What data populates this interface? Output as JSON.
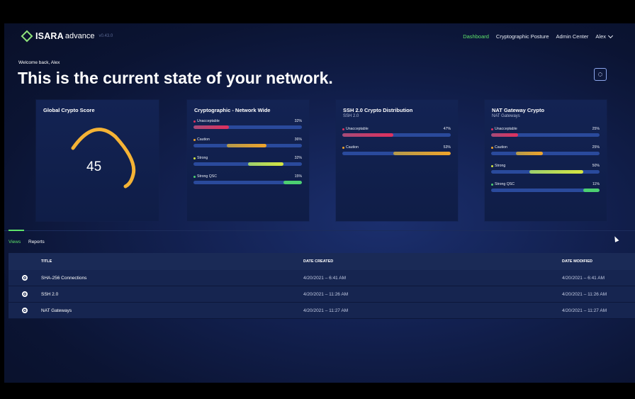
{
  "app": {
    "brand": "ISARA",
    "product": "advance",
    "version": "v0.43.0"
  },
  "nav": {
    "links": [
      "Dashboard",
      "Cryptographic Posture",
      "Admin Center"
    ],
    "active": "Dashboard",
    "user": "Alex"
  },
  "hero": {
    "welcome": "Welcome back, Alex",
    "headline": "This is the current state of your network."
  },
  "cards": {
    "global": {
      "title": "Global Crypto Score",
      "score": "45",
      "gauge_color": "#f5b335"
    },
    "network": {
      "title": "Cryptographic - Network Wide",
      "metrics": [
        {
          "label": "Unacceptable",
          "value": "32%",
          "color": "#e0305e"
        },
        {
          "label": "Caution",
          "value": "36%",
          "color": "#f0a42a"
        },
        {
          "label": "Strong",
          "value": "32%",
          "color": "#d6e640"
        },
        {
          "label": "Strong QSC",
          "value": "15%",
          "color": "#4cd071"
        }
      ]
    },
    "ssh": {
      "title": "SSH 2.0 Crypto Distribution",
      "subtitle": "SSH 2.0",
      "metrics": [
        {
          "label": "Unacceptable",
          "value": "47%",
          "color": "#e0305e"
        },
        {
          "label": "Caution",
          "value": "53%",
          "color": "#f0a42a"
        }
      ]
    },
    "nat": {
      "title": "NAT Gateway Crypto",
      "subtitle": "NAT Gateways",
      "metrics": [
        {
          "label": "Unacceptable",
          "value": "25%",
          "color": "#e0305e"
        },
        {
          "label": "Caution",
          "value": "25%",
          "color": "#f0a42a"
        },
        {
          "label": "Strong",
          "value": "50%",
          "color": "#d6e640"
        },
        {
          "label": "Strong QSC",
          "value": "11%",
          "color": "#4cd071"
        }
      ]
    }
  },
  "tabs": {
    "views": "Views",
    "reports": "Reports"
  },
  "table": {
    "headers": {
      "title": "TITLE",
      "created": "DATE CREATED",
      "modified": "DATE MODIFIED"
    },
    "rows": [
      {
        "title": "SHA-256 Connections",
        "created": "4/20/2021 – 6:41 AM",
        "modified": "4/20/2021 – 6:41 AM"
      },
      {
        "title": "SSH 2.0",
        "created": "4/20/2021 – 11:26 AM",
        "modified": "4/20/2021 – 11:26 AM"
      },
      {
        "title": "NAT Gateways",
        "created": "4/20/2021 – 11:27 AM",
        "modified": "4/20/2021 – 11:27 AM"
      }
    ]
  }
}
